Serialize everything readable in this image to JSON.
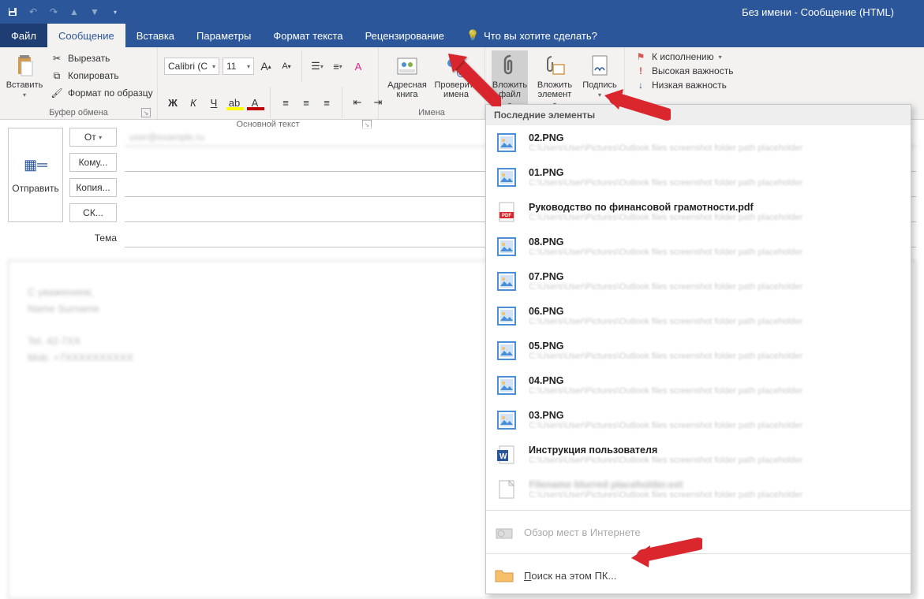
{
  "window": {
    "title": "Без имени - Сообщение (HTML)"
  },
  "tabs": {
    "file": "Файл",
    "message": "Сообщение",
    "insert": "Вставка",
    "options": "Параметры",
    "format": "Формат текста",
    "review": "Рецензирование",
    "tellme": "Что вы хотите сделать?"
  },
  "ribbon": {
    "paste": "Вставить",
    "cut": "Вырезать",
    "copy": "Копировать",
    "format_painter": "Формат по образцу",
    "clipboard_label": "Буфер обмена",
    "font_name": "Calibri (С",
    "font_size": "11",
    "basictext_label": "Основной текст",
    "address_book": "Адресная книга",
    "check_names": "Проверить имена",
    "names_label": "Имена",
    "attach_file": "Вложить файл",
    "attach_item": "Вложить элемент",
    "signature": "Подпись",
    "follow_up": "К исполнению",
    "high_importance": "Высокая важность",
    "low_importance": "Низкая важность"
  },
  "compose": {
    "send": "Отправить",
    "from": "От",
    "to": "Кому...",
    "cc": "Копия...",
    "bcc": "СК...",
    "subject": "Тема"
  },
  "dropdown": {
    "header": "Последние элементы",
    "items": [
      {
        "name": "02.PNG",
        "type": "image"
      },
      {
        "name": "01.PNG",
        "type": "image"
      },
      {
        "name": "Руководство по финансовой грамотности.pdf",
        "type": "pdf"
      },
      {
        "name": "08.PNG",
        "type": "image"
      },
      {
        "name": "07.PNG",
        "type": "image"
      },
      {
        "name": "06.PNG",
        "type": "image"
      },
      {
        "name": "05.PNG",
        "type": "image"
      },
      {
        "name": "04.PNG",
        "type": "image"
      },
      {
        "name": "03.PNG",
        "type": "image"
      },
      {
        "name": "Инструкция пользователя",
        "type": "word"
      },
      {
        "name": "",
        "type": "generic"
      }
    ],
    "browse_web": "Обзор мест в Интернете",
    "browse_pc": "Поиск на этом ПК..."
  },
  "blurred_path": "C:\\Users\\User\\Pictures\\Outlook files screenshot folder path placeholder"
}
